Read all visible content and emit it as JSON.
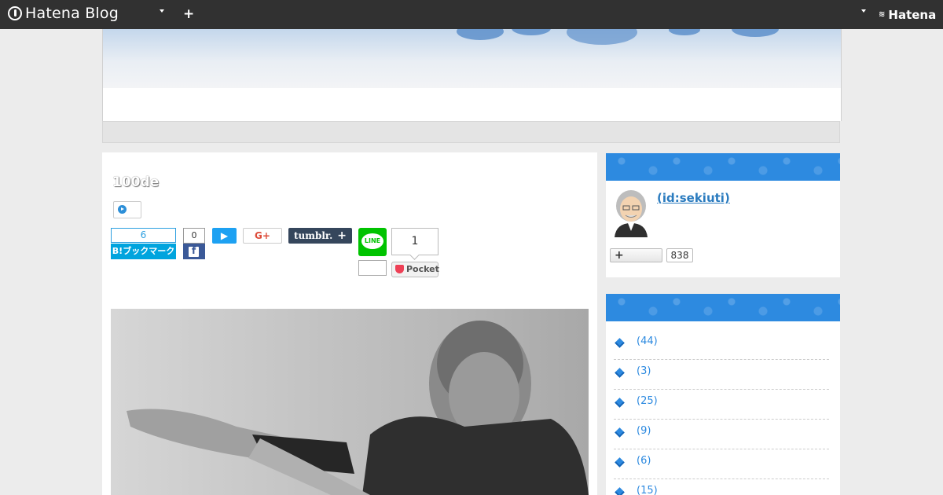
{
  "topbar": {
    "logo_text": "Hatena Blog",
    "add_label": "+",
    "brand_right": "Hatena"
  },
  "article": {
    "title": "100de",
    "share": {
      "hatena_count": "6",
      "hatena_label": "B!ブックマーク",
      "facebook_count": "0",
      "gplus_label": "G+",
      "tumblr_label": "tumblr.",
      "tumblr_plus": "+",
      "line_label": "LINE",
      "pocket_count": "1",
      "pocket_label": "Pocket"
    }
  },
  "profile": {
    "name": " (id:sekiuti)",
    "follow_label": "+",
    "follower_count": "838"
  },
  "categories": [
    {
      "count": "(44)"
    },
    {
      "count": "(3)"
    },
    {
      "count": "(25)"
    },
    {
      "count": "(9)"
    },
    {
      "count": "(6)"
    },
    {
      "count": "(15)"
    }
  ],
  "colors": {
    "topbar": "#313131",
    "accent_blue": "#2d8ae0",
    "hatena_blue": "#00a4de",
    "facebook": "#3b5998",
    "twitter": "#1da1f2",
    "tumblr": "#35465c",
    "line": "#00c300",
    "pocket": "#ee4056"
  },
  "icons": [
    "hatena-blog-logo-icon",
    "caret-down-icon",
    "plus-icon",
    "play-icon",
    "twitter-icon",
    "facebook-icon",
    "pocket-icon",
    "diamond-bullet-icon"
  ]
}
